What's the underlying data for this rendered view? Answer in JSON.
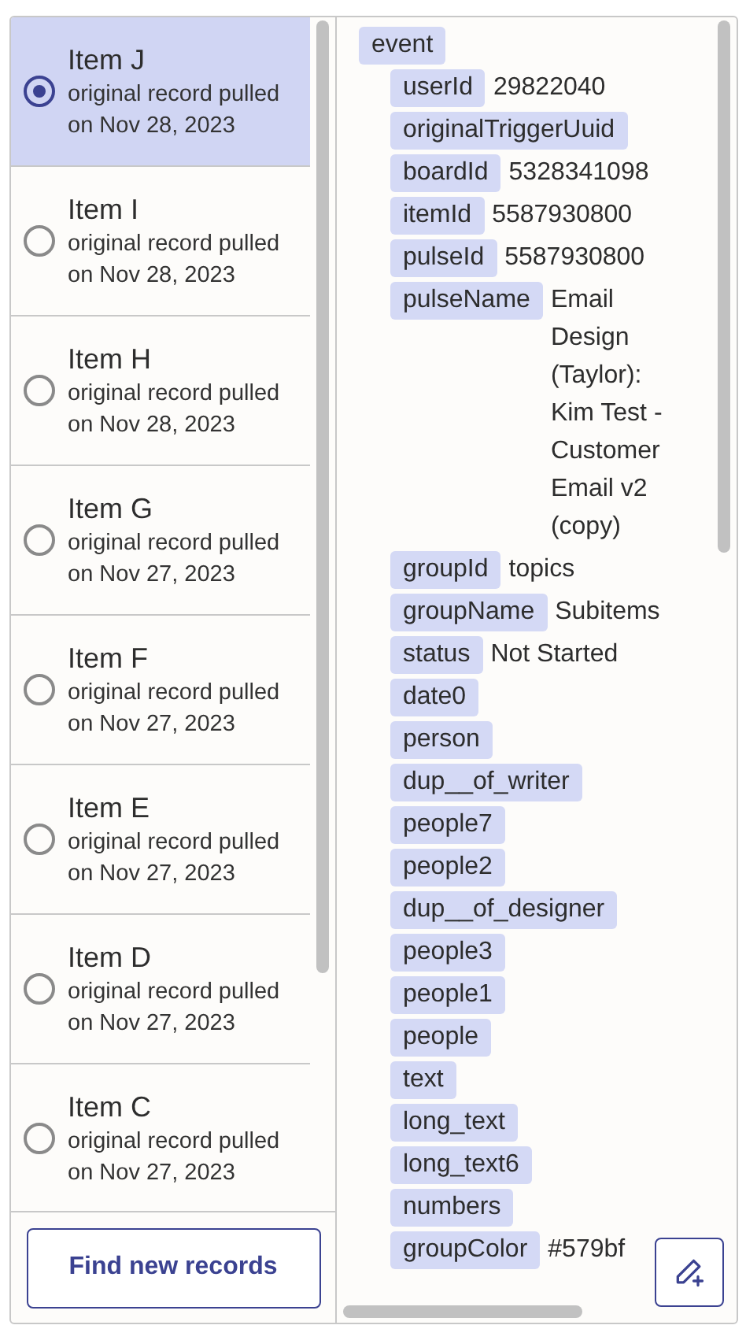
{
  "records": [
    {
      "title": "Item J",
      "subtitle": "original record pulled on Nov 28, 2023",
      "selected": true
    },
    {
      "title": "Item I",
      "subtitle": "original record pulled on Nov 28, 2023",
      "selected": false
    },
    {
      "title": "Item H",
      "subtitle": "original record pulled on Nov 28, 2023",
      "selected": false
    },
    {
      "title": "Item G",
      "subtitle": "original record pulled on Nov 27, 2023",
      "selected": false
    },
    {
      "title": "Item F",
      "subtitle": "original record pulled on Nov 27, 2023",
      "selected": false
    },
    {
      "title": "Item E",
      "subtitle": "original record pulled on Nov 27, 2023",
      "selected": false
    },
    {
      "title": "Item D",
      "subtitle": "original record pulled on Nov 27, 2023",
      "selected": false
    },
    {
      "title": "Item C",
      "subtitle": "original record pulled on Nov 27, 2023",
      "selected": false
    }
  ],
  "find_button": "Find new records",
  "tree": [
    {
      "key": "event",
      "children": [
        {
          "key": "userId",
          "value": "29822040"
        },
        {
          "key": "originalTriggerUuid"
        },
        {
          "key": "boardId",
          "value": "5328341098"
        },
        {
          "key": "itemId",
          "value": "5587930800"
        },
        {
          "key": "pulseId",
          "value": "5587930800"
        },
        {
          "key": "pulseName",
          "value": "Email Design (Taylor): Kim Test - Customer Email v2 (copy)"
        },
        {
          "key": "groupId",
          "value": "topics"
        },
        {
          "key": "groupName",
          "value": "Subitems"
        },
        {
          "key": "status",
          "value": "Not Started"
        },
        {
          "key": "date0"
        },
        {
          "key": "person"
        },
        {
          "key": "dup__of_writer"
        },
        {
          "key": "people7"
        },
        {
          "key": "people2"
        },
        {
          "key": "dup__of_designer"
        },
        {
          "key": "people3"
        },
        {
          "key": "people1"
        },
        {
          "key": "people"
        },
        {
          "key": "text"
        },
        {
          "key": "long_text"
        },
        {
          "key": "long_text6"
        },
        {
          "key": "numbers"
        },
        {
          "key": "groupColor",
          "value": "#579bf"
        }
      ]
    }
  ]
}
